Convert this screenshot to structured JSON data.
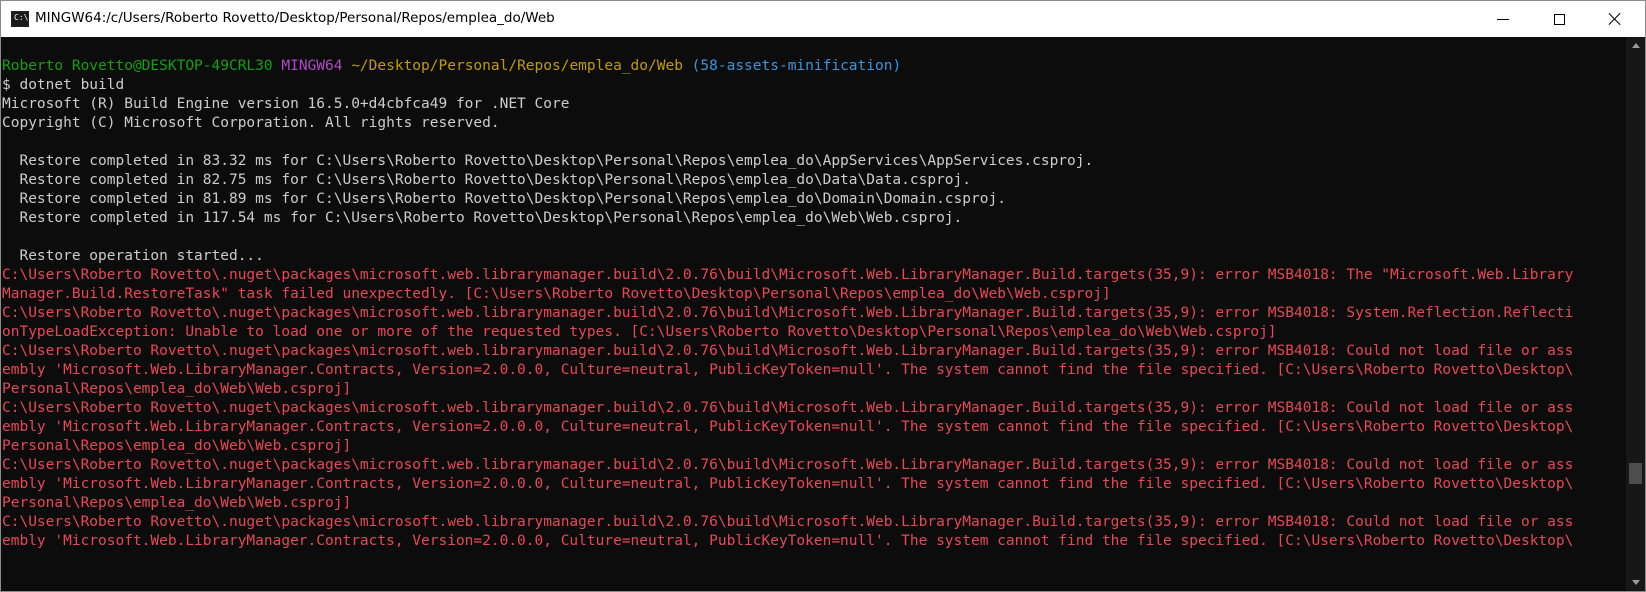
{
  "window": {
    "title": "MINGW64:/c/Users/Roberto Rovetto/Desktop/Personal/Repos/emplea_do/Web",
    "icon": "terminal-icon",
    "controls": {
      "minimize": "minimize-icon",
      "maximize": "maximize-icon",
      "close": "close-icon"
    }
  },
  "prompt": {
    "user_host": "Roberto Rovetto@DESKTOP-49CRL30",
    "shell": "MINGW64",
    "path": "~/Desktop/Personal/Repos/emplea_do/Web",
    "branch": "(58-assets-minification)",
    "symbol": "$",
    "command": "dotnet build"
  },
  "output": {
    "header": [
      "Microsoft (R) Build Engine version 16.5.0+d4cbfca49 for .NET Core",
      "Copyright (C) Microsoft Corporation. All rights reserved."
    ],
    "restore": [
      "  Restore completed in 83.32 ms for C:\\Users\\Roberto Rovetto\\Desktop\\Personal\\Repos\\emplea_do\\AppServices\\AppServices.csproj.",
      "  Restore completed in 82.75 ms for C:\\Users\\Roberto Rovetto\\Desktop\\Personal\\Repos\\emplea_do\\Data\\Data.csproj.",
      "  Restore completed in 81.89 ms for C:\\Users\\Roberto Rovetto\\Desktop\\Personal\\Repos\\emplea_do\\Domain\\Domain.csproj.",
      "  Restore completed in 117.54 ms for C:\\Users\\Roberto Rovetto\\Desktop\\Personal\\Repos\\emplea_do\\Web\\Web.csproj."
    ],
    "restore_started": "  Restore operation started...",
    "errors": [
      "C:\\Users\\Roberto Rovetto\\.nuget\\packages\\microsoft.web.librarymanager.build\\2.0.76\\build\\Microsoft.Web.LibraryManager.Build.targets(35,9): error MSB4018: The \"Microsoft.Web.Library",
      "Manager.Build.RestoreTask\" task failed unexpectedly. [C:\\Users\\Roberto Rovetto\\Desktop\\Personal\\Repos\\emplea_do\\Web\\Web.csproj]",
      "C:\\Users\\Roberto Rovetto\\.nuget\\packages\\microsoft.web.librarymanager.build\\2.0.76\\build\\Microsoft.Web.LibraryManager.Build.targets(35,9): error MSB4018: System.Reflection.Reflecti",
      "onTypeLoadException: Unable to load one or more of the requested types. [C:\\Users\\Roberto Rovetto\\Desktop\\Personal\\Repos\\emplea_do\\Web\\Web.csproj]",
      "C:\\Users\\Roberto Rovetto\\.nuget\\packages\\microsoft.web.librarymanager.build\\2.0.76\\build\\Microsoft.Web.LibraryManager.Build.targets(35,9): error MSB4018: Could not load file or ass",
      "embly 'Microsoft.Web.LibraryManager.Contracts, Version=2.0.0.0, Culture=neutral, PublicKeyToken=null'. The system cannot find the file specified. [C:\\Users\\Roberto Rovetto\\Desktop\\",
      "Personal\\Repos\\emplea_do\\Web\\Web.csproj]",
      "C:\\Users\\Roberto Rovetto\\.nuget\\packages\\microsoft.web.librarymanager.build\\2.0.76\\build\\Microsoft.Web.LibraryManager.Build.targets(35,9): error MSB4018: Could not load file or ass",
      "embly 'Microsoft.Web.LibraryManager.Contracts, Version=2.0.0.0, Culture=neutral, PublicKeyToken=null'. The system cannot find the file specified. [C:\\Users\\Roberto Rovetto\\Desktop\\",
      "Personal\\Repos\\emplea_do\\Web\\Web.csproj]",
      "C:\\Users\\Roberto Rovetto\\.nuget\\packages\\microsoft.web.librarymanager.build\\2.0.76\\build\\Microsoft.Web.LibraryManager.Build.targets(35,9): error MSB4018: Could not load file or ass",
      "embly 'Microsoft.Web.LibraryManager.Contracts, Version=2.0.0.0, Culture=neutral, PublicKeyToken=null'. The system cannot find the file specified. [C:\\Users\\Roberto Rovetto\\Desktop\\",
      "Personal\\Repos\\emplea_do\\Web\\Web.csproj]",
      "C:\\Users\\Roberto Rovetto\\.nuget\\packages\\microsoft.web.librarymanager.build\\2.0.76\\build\\Microsoft.Web.LibraryManager.Build.targets(35,9): error MSB4018: Could not load file or ass",
      "embly 'Microsoft.Web.LibraryManager.Contracts, Version=2.0.0.0, Culture=neutral, PublicKeyToken=null'. The system cannot find the file specified. [C:\\Users\\Roberto Rovetto\\Desktop\\"
    ]
  },
  "colors": {
    "background": "#0c0c0c",
    "text": "#cccccc",
    "user": "#13a10e",
    "shell": "#b148c6",
    "path": "#c19c00",
    "branch": "#3a96dd",
    "error": "#e74856"
  },
  "scrollbar": {
    "up": "scroll-up-arrow-icon",
    "down": "scroll-down-arrow-icon"
  }
}
